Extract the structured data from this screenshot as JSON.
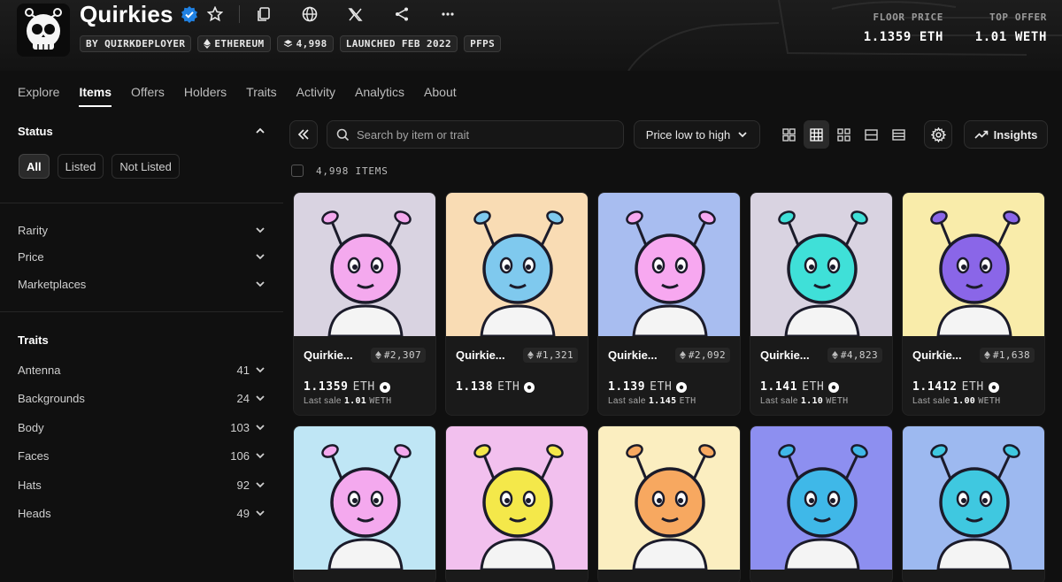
{
  "collection": {
    "title": "Quirkies",
    "tags": [
      "BY QUIRKDEPLOYER",
      "ETHEREUM",
      "4,998",
      "LAUNCHED FEB 2022",
      "PFPS"
    ],
    "floor_label": "FLOOR PRICE",
    "floor_value": "1.1359 ETH",
    "offer_label": "TOP OFFER",
    "offer_value": "1.01 WETH"
  },
  "nav": [
    "Explore",
    "Items",
    "Offers",
    "Holders",
    "Traits",
    "Activity",
    "Analytics",
    "About"
  ],
  "sidebar": {
    "status_title": "Status",
    "status_options": [
      "All",
      "Listed",
      "Not Listed"
    ],
    "filters": [
      "Rarity",
      "Price",
      "Marketplaces"
    ],
    "traits_title": "Traits",
    "traits": [
      {
        "label": "Antenna",
        "count": "41"
      },
      {
        "label": "Backgrounds",
        "count": "24"
      },
      {
        "label": "Body",
        "count": "103"
      },
      {
        "label": "Faces",
        "count": "106"
      },
      {
        "label": "Hats",
        "count": "92"
      },
      {
        "label": "Heads",
        "count": "49"
      }
    ]
  },
  "toolbar": {
    "search_placeholder": "Search by item or trait",
    "sort_label": "Price low to high",
    "insights_label": "Insights",
    "items_count": "4,998 ITEMS"
  },
  "cards": [
    {
      "name": "Quirkie...",
      "token": "#2,307",
      "price": "1.1359",
      "currency": "ETH",
      "last_label": "Last sale",
      "last_value": "1.01",
      "last_currency": "WETH",
      "bg": "#d9d3e1",
      "head": "#f4a9ee"
    },
    {
      "name": "Quirkie...",
      "token": "#1,321",
      "price": "1.138",
      "currency": "ETH",
      "last_label": "",
      "last_value": "",
      "last_currency": "",
      "bg": "#f9dcb4",
      "head": "#7fc9ee"
    },
    {
      "name": "Quirkie...",
      "token": "#2,092",
      "price": "1.139",
      "currency": "ETH",
      "last_label": "Last sale",
      "last_value": "1.145",
      "last_currency": "ETH",
      "bg": "#a8bdf0",
      "head": "#f7a8f0"
    },
    {
      "name": "Quirkie...",
      "token": "#4,823",
      "price": "1.141",
      "currency": "ETH",
      "last_label": "Last sale",
      "last_value": "1.10",
      "last_currency": "WETH",
      "bg": "#d9d3e1",
      "head": "#3fe0d8"
    },
    {
      "name": "Quirkie...",
      "token": "#1,638",
      "price": "1.1412",
      "currency": "ETH",
      "last_label": "Last sale",
      "last_value": "1.00",
      "last_currency": "WETH",
      "bg": "#f9ecaa",
      "head": "#8a66e8"
    },
    {
      "bg": "#bfe6f5",
      "head": "#f4a9ee"
    },
    {
      "bg": "#f2c0ee",
      "head": "#f4e84a"
    },
    {
      "bg": "#fbeec0",
      "head": "#f7a860"
    },
    {
      "bg": "#8d8ff0",
      "head": "#3fb8e8"
    },
    {
      "bg": "#9db9f0",
      "head": "#3fc8e0"
    }
  ],
  "colors": {
    "accent": "#2081e2",
    "background": "#101010"
  }
}
